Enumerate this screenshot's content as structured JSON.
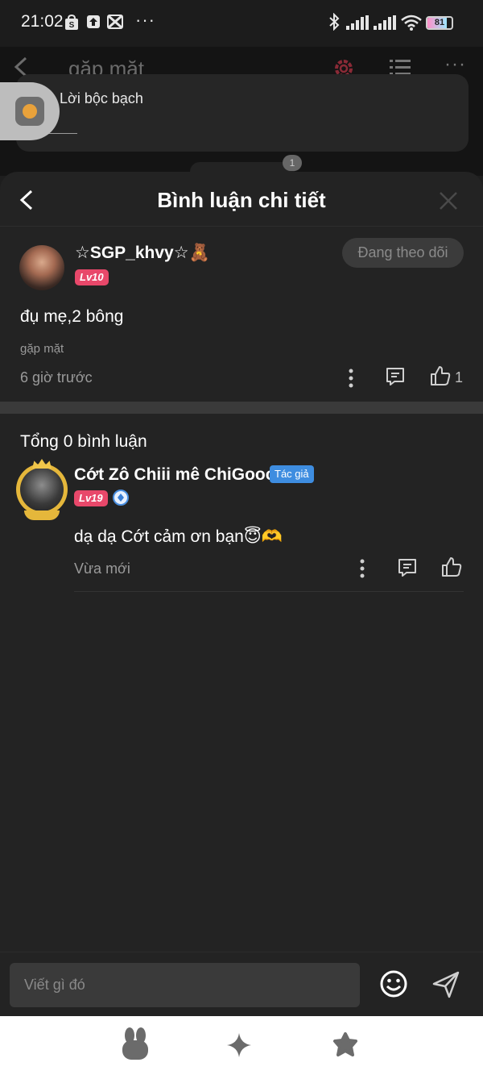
{
  "status_bar": {
    "time": "21:02",
    "more": "···",
    "battery": "81"
  },
  "background": {
    "title": "gặp mặt",
    "card_title": "Lời bộc bạch",
    "badge": "1"
  },
  "sheet": {
    "title": "Bình luận chi tiết",
    "post": {
      "username": "☆SGP_khvy☆🧸",
      "level": "Lv10",
      "follow_label": "Đang theo dõi",
      "text": "đụ mẹ,2 bông",
      "topic": "gặp mặt",
      "time": "6 giờ trước",
      "like_count": "1"
    },
    "total_label": "Tổng 0 bình luận",
    "reply": {
      "username": "Cớt Zô Chiii mê ChiGooo",
      "author_tag": "Tác giả",
      "level": "Lv19",
      "text": "dạ dạ Cớt cảm ơn bạn😇🫶",
      "time": "Vừa mới"
    }
  },
  "input": {
    "placeholder": "Viết gì đó"
  },
  "colors": {
    "sheet_bg": "#232323",
    "level_badge": "#e8486a",
    "author_tag": "#3e8de0",
    "accent_red": "#c0394b"
  },
  "icons": {
    "header_back": "chevron-left-icon",
    "header_close": "close-icon",
    "more": "more-vertical-icon",
    "comment": "comment-icon",
    "like": "thumbs-up-icon",
    "emoji": "emoji-icon",
    "send": "send-icon",
    "nav": [
      "bunny-icon",
      "sparkle-icon",
      "star-blob-icon"
    ]
  }
}
